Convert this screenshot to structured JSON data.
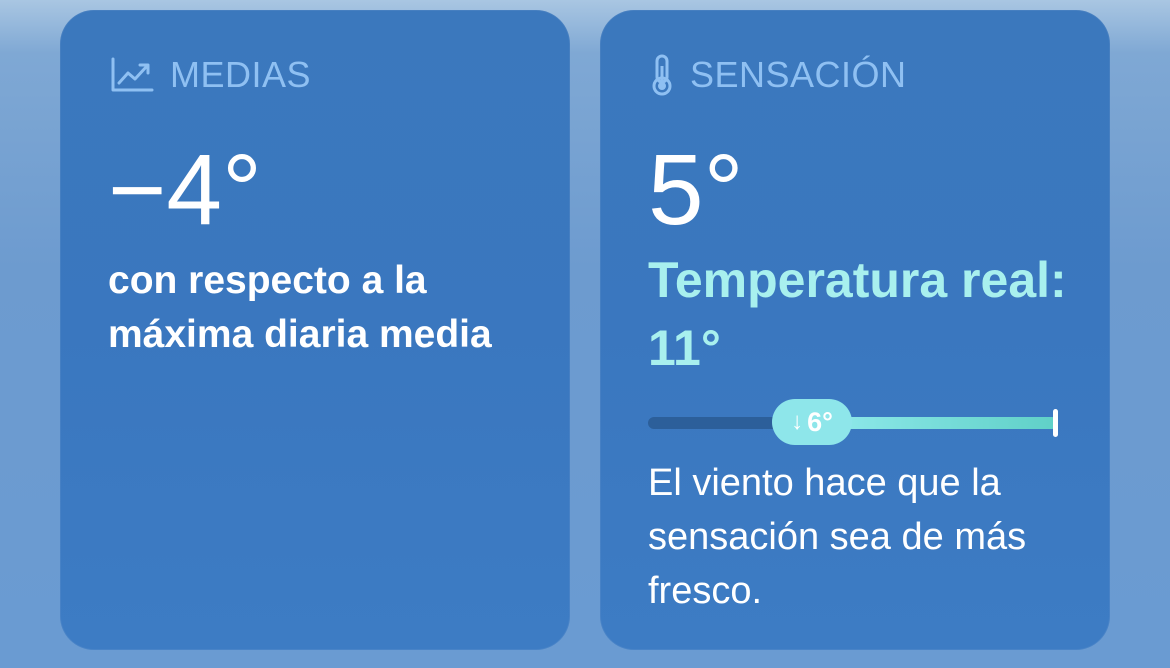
{
  "medias": {
    "header": "MEDIAS",
    "value": "−4°",
    "description": "con respecto a la máxima diaria media"
  },
  "sensacion": {
    "header": "SENSACIÓN",
    "value": "5°",
    "real_temperature": "Temperatura real: 11°",
    "wind_chill_badge": "6°",
    "wind_chill_fraction": 0.35,
    "description": "El viento hace que la sensación sea de más fresco."
  },
  "colors": {
    "card_bg": "#3b78bd",
    "header_text": "#8fc0f2",
    "accent_teal": "#a8f0ee"
  },
  "icons": {
    "medias": "trend-chart-icon",
    "sensacion": "thermometer-icon",
    "pill_arrow": "arrow-down-icon"
  }
}
